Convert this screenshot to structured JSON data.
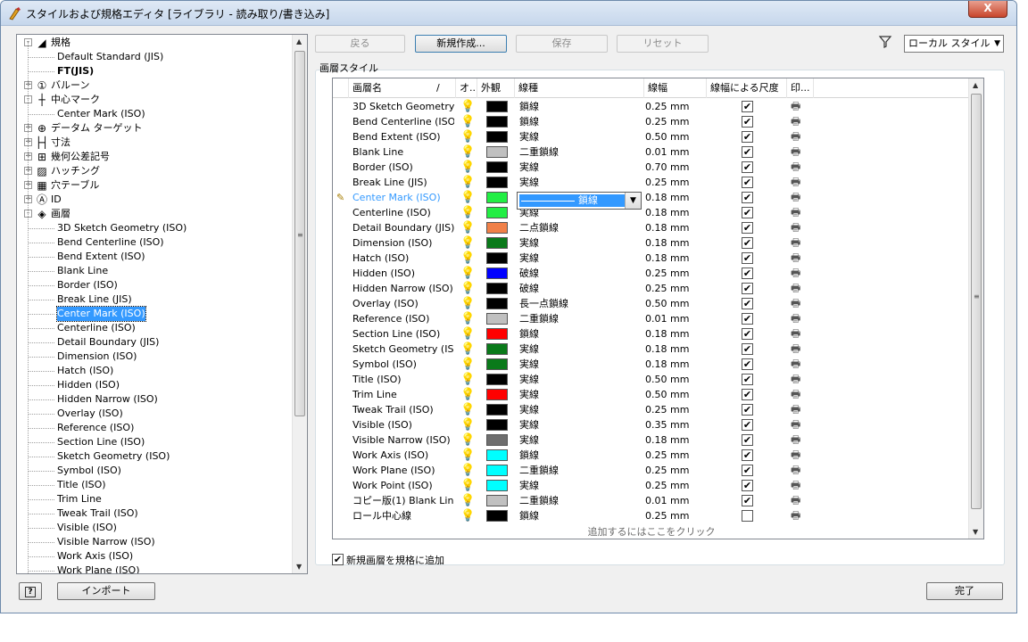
{
  "window": {
    "title": "スタイルおよび規格エディタ [ライブラリ - 読み取り/書き込み]",
    "close_label": "X"
  },
  "toolbar": {
    "back": "戻る",
    "new": "新規作成...",
    "save": "保存",
    "reset": "リセット",
    "filter_value": "ローカル スタイル"
  },
  "tree": {
    "items": [
      {
        "label": "規格",
        "level": 0,
        "expander": "-",
        "icon": "standards-icon"
      },
      {
        "label": "Default Standard (JIS)",
        "level": 1
      },
      {
        "label": "FT(JIS)",
        "level": 1,
        "bold": true
      },
      {
        "label": "バルーン",
        "level": 0,
        "expander": "+",
        "icon": "balloon-icon"
      },
      {
        "label": "中心マーク",
        "level": 0,
        "expander": "-",
        "icon": "center-mark-icon"
      },
      {
        "label": "Center Mark (ISO)",
        "level": 1
      },
      {
        "label": "データム ターゲット",
        "level": 0,
        "expander": "+",
        "icon": "datum-target-icon"
      },
      {
        "label": "寸法",
        "level": 0,
        "expander": "+",
        "icon": "dimension-icon"
      },
      {
        "label": "幾何公差記号",
        "level": 0,
        "expander": "+",
        "icon": "feature-control-frame-icon"
      },
      {
        "label": "ハッチング",
        "level": 0,
        "expander": "+",
        "icon": "hatch-icon"
      },
      {
        "label": "穴テーブル",
        "level": 0,
        "expander": "+",
        "icon": "hole-table-icon"
      },
      {
        "label": "ID",
        "level": 0,
        "expander": "+",
        "icon": "id-icon"
      },
      {
        "label": "画層",
        "level": 0,
        "expander": "-",
        "icon": "layer-icon"
      },
      {
        "label": "3D Sketch Geometry (ISO)",
        "level": 1
      },
      {
        "label": "Bend Centerline (ISO)",
        "level": 1
      },
      {
        "label": "Bend Extent (ISO)",
        "level": 1
      },
      {
        "label": "Blank Line",
        "level": 1
      },
      {
        "label": "Border (ISO)",
        "level": 1
      },
      {
        "label": "Break Line (JIS)",
        "level": 1
      },
      {
        "label": "Center Mark (ISO)",
        "level": 1,
        "selected": true
      },
      {
        "label": "Centerline (ISO)",
        "level": 1
      },
      {
        "label": "Detail Boundary (JIS)",
        "level": 1
      },
      {
        "label": "Dimension (ISO)",
        "level": 1
      },
      {
        "label": "Hatch (ISO)",
        "level": 1
      },
      {
        "label": "Hidden (ISO)",
        "level": 1
      },
      {
        "label": "Hidden Narrow (ISO)",
        "level": 1
      },
      {
        "label": "Overlay (ISO)",
        "level": 1
      },
      {
        "label": "Reference (ISO)",
        "level": 1
      },
      {
        "label": "Section Line (ISO)",
        "level": 1
      },
      {
        "label": "Sketch Geometry (ISO)",
        "level": 1
      },
      {
        "label": "Symbol (ISO)",
        "level": 1
      },
      {
        "label": "Title (ISO)",
        "level": 1
      },
      {
        "label": "Trim Line",
        "level": 1
      },
      {
        "label": "Tweak Trail (ISO)",
        "level": 1
      },
      {
        "label": "Visible (ISO)",
        "level": 1
      },
      {
        "label": "Visible Narrow (ISO)",
        "level": 1
      },
      {
        "label": "Work Axis (ISO)",
        "level": 1
      },
      {
        "label": "Work Plane (ISO)",
        "level": 1
      }
    ]
  },
  "group": {
    "label": "画層スタイル"
  },
  "grid": {
    "columns": {
      "name": "画層名",
      "sort_mark": "/",
      "on": "オ..",
      "appearance": "外観",
      "linetype": "線種",
      "weight": "線幅",
      "scale": "線幅による尺度",
      "print": "印..."
    },
    "rows": [
      {
        "name": "3D Sketch Geometry (",
        "color": "#000000",
        "linetype": "鎖線",
        "weight": "0.25 mm",
        "scale": true
      },
      {
        "name": "Bend Centerline (ISO)",
        "color": "#000000",
        "linetype": "鎖線",
        "weight": "0.25 mm",
        "scale": true
      },
      {
        "name": "Bend Extent (ISO)",
        "color": "#000000",
        "linetype": "実線",
        "weight": "0.50 mm",
        "scale": true
      },
      {
        "name": "Blank Line",
        "color": "#c0c0c0",
        "linetype": "二重鎖線",
        "weight": "0.01 mm",
        "scale": true
      },
      {
        "name": "Border (ISO)",
        "color": "#000000",
        "linetype": "実線",
        "weight": "0.70 mm",
        "scale": true
      },
      {
        "name": "Break Line (JIS)",
        "color": "#000000",
        "linetype": "実線",
        "weight": "0.25 mm",
        "scale": true
      },
      {
        "name": "Center Mark (ISO)",
        "color": "#22ee44",
        "linetype": "",
        "weight": "0.18 mm",
        "scale": true,
        "editing": true
      },
      {
        "name": "Centerline (ISO)",
        "color": "#22ee44",
        "linetype": "実線",
        "weight": "0.18 mm",
        "scale": true
      },
      {
        "name": "Detail Boundary (JIS)",
        "color": "#f08048",
        "linetype": "二点鎖線",
        "weight": "0.18 mm",
        "scale": true
      },
      {
        "name": "Dimension (ISO)",
        "color": "#0a7a1a",
        "linetype": "実線",
        "weight": "0.18 mm",
        "scale": true
      },
      {
        "name": "Hatch (ISO)",
        "color": "#000000",
        "linetype": "実線",
        "weight": "0.18 mm",
        "scale": true
      },
      {
        "name": "Hidden (ISO)",
        "color": "#0000ff",
        "linetype": "破線",
        "weight": "0.25 mm",
        "scale": true
      },
      {
        "name": "Hidden Narrow (ISO)",
        "color": "#000000",
        "linetype": "破線",
        "weight": "0.25 mm",
        "scale": true
      },
      {
        "name": "Overlay (ISO)",
        "color": "#000000",
        "linetype": "長一点鎖線",
        "weight": "0.50 mm",
        "scale": true
      },
      {
        "name": "Reference (ISO)",
        "color": "#c0c0c0",
        "linetype": "二重鎖線",
        "weight": "0.01 mm",
        "scale": true
      },
      {
        "name": "Section Line (ISO)",
        "color": "#ff0000",
        "linetype": "鎖線",
        "weight": "0.18 mm",
        "scale": true
      },
      {
        "name": "Sketch Geometry (ISO",
        "color": "#0a7a1a",
        "linetype": "実線",
        "weight": "0.18 mm",
        "scale": true
      },
      {
        "name": "Symbol (ISO)",
        "color": "#0a7a1a",
        "linetype": "実線",
        "weight": "0.18 mm",
        "scale": true
      },
      {
        "name": "Title (ISO)",
        "color": "#000000",
        "linetype": "実線",
        "weight": "0.50 mm",
        "scale": true
      },
      {
        "name": "Trim Line",
        "color": "#ff0000",
        "linetype": "実線",
        "weight": "0.50 mm",
        "scale": true
      },
      {
        "name": "Tweak Trail (ISO)",
        "color": "#000000",
        "linetype": "実線",
        "weight": "0.25 mm",
        "scale": true
      },
      {
        "name": "Visible (ISO)",
        "color": "#000000",
        "linetype": "実線",
        "weight": "0.35 mm",
        "scale": true
      },
      {
        "name": "Visible Narrow (ISO)",
        "color": "#6e6e6e",
        "linetype": "実線",
        "weight": "0.18 mm",
        "scale": true
      },
      {
        "name": "Work Axis (ISO)",
        "color": "#00ffff",
        "linetype": "鎖線",
        "weight": "0.25 mm",
        "scale": true
      },
      {
        "name": "Work Plane (ISO)",
        "color": "#00ffff",
        "linetype": "二重鎖線",
        "weight": "0.25 mm",
        "scale": true
      },
      {
        "name": "Work Point (ISO)",
        "color": "#00ffff",
        "linetype": "実線",
        "weight": "0.25 mm",
        "scale": true
      },
      {
        "name": "コピー版(1) Blank Line",
        "color": "#c0c0c0",
        "linetype": "二重鎖線",
        "weight": "0.01 mm",
        "scale": true
      },
      {
        "name": "ロール中心線",
        "color": "#000000",
        "linetype": "鎖線",
        "weight": "0.25 mm",
        "scale": false
      }
    ],
    "editor": {
      "value": "鎖線"
    },
    "add_row_text": "追加するにはここをクリック"
  },
  "options": {
    "add_to_standard_label": "新規画層を規格に追加",
    "add_to_standard_checked": true
  },
  "footer": {
    "help": "?",
    "import": "インポート",
    "done": "完了"
  },
  "icons": {
    "bulb": "lightbulb-on-icon",
    "print": "printer-icon",
    "filter": "filter-icon",
    "pencil": "edit-pencil-icon"
  }
}
